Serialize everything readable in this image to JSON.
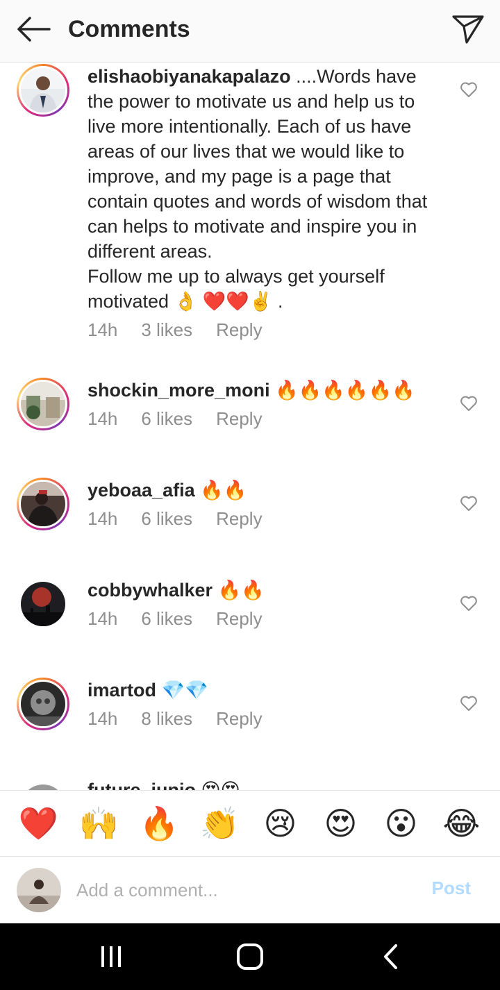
{
  "header": {
    "title": "Comments",
    "back_icon": "arrow-left-icon",
    "send_icon": "paper-plane-icon"
  },
  "comments": [
    {
      "username": "elishaobiyanakapalazo",
      "text": " ....Words have the power to motivate us and help us to live more intentionally. Each of us have areas of our lives that we would like to improve, and my page is a page that contain quotes and words of wisdom that can helps to motivate and inspire you in different areas.\nFollow me up to always get yourself motivated 👌 ❤️❤️✌️ .",
      "time": "14h",
      "likes": "3 likes",
      "reply": "Reply"
    },
    {
      "username": "shockin_more_moni",
      "text": " 🔥🔥🔥🔥🔥🔥",
      "time": "14h",
      "likes": "6 likes",
      "reply": "Reply"
    },
    {
      "username": "yeboaa_afia",
      "text": " 🔥🔥",
      "time": "14h",
      "likes": "6 likes",
      "reply": "Reply"
    },
    {
      "username": "cobbywhalker",
      "text": " 🔥🔥",
      "time": "14h",
      "likes": "6 likes",
      "reply": "Reply"
    },
    {
      "username": "imartod",
      "text": " 💎💎",
      "time": "14h",
      "likes": "8 likes",
      "reply": "Reply"
    },
    {
      "username": "future_junio",
      "text": " 😍😍"
    }
  ],
  "reactions": [
    "❤️",
    "🙌",
    "🔥",
    "👏",
    "😢",
    "😍",
    "😮",
    "😂"
  ],
  "composer": {
    "placeholder": "Add a comment...",
    "post_label": "Post"
  },
  "colors": {
    "post_disabled": "#b3dbff",
    "meta_gray": "#8e8e8e"
  }
}
